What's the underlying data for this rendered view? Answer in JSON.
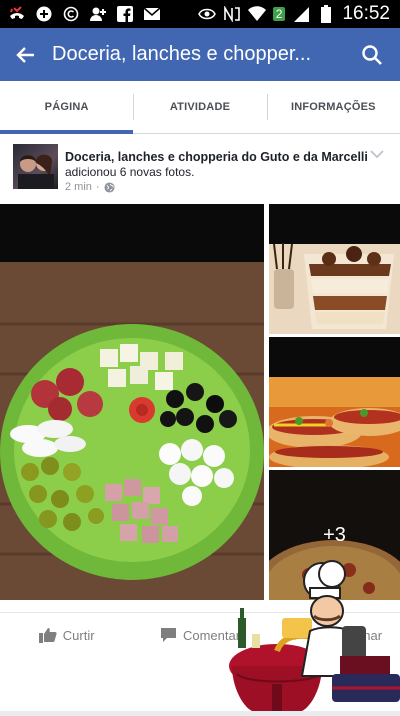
{
  "statusbar": {
    "time": "16:52",
    "badge": "2",
    "left_icons": [
      "missed-call-icon",
      "add-contact-icon",
      "copyright-icon",
      "user-add-icon",
      "facebook-icon",
      "mail-icon"
    ],
    "right_icons": [
      "eye-icon",
      "nfc-icon",
      "wifi-icon",
      "data-badge-icon",
      "signal-icon",
      "battery-icon"
    ]
  },
  "appbar": {
    "title": "Doceria, lanches e chopper...",
    "color": "#4267b2"
  },
  "tabs": [
    {
      "label": "PÁGINA",
      "active": true
    },
    {
      "label": "ATIVIDADE",
      "active": false
    },
    {
      "label": "INFORMAÇÕES",
      "active": false
    }
  ],
  "post": {
    "author": "Doceria, lanches e chopperia do Guto e da Marcelli",
    "action": "adicionou 6 novas fotos.",
    "time": "2 min",
    "separator": "·",
    "more_photos": "+3"
  },
  "actions": [
    {
      "label": "Curtir",
      "icon": "like-icon"
    },
    {
      "label": "Comentar",
      "icon": "comment-icon"
    },
    {
      "label": "Compartilhar",
      "icon": "share-icon"
    }
  ]
}
